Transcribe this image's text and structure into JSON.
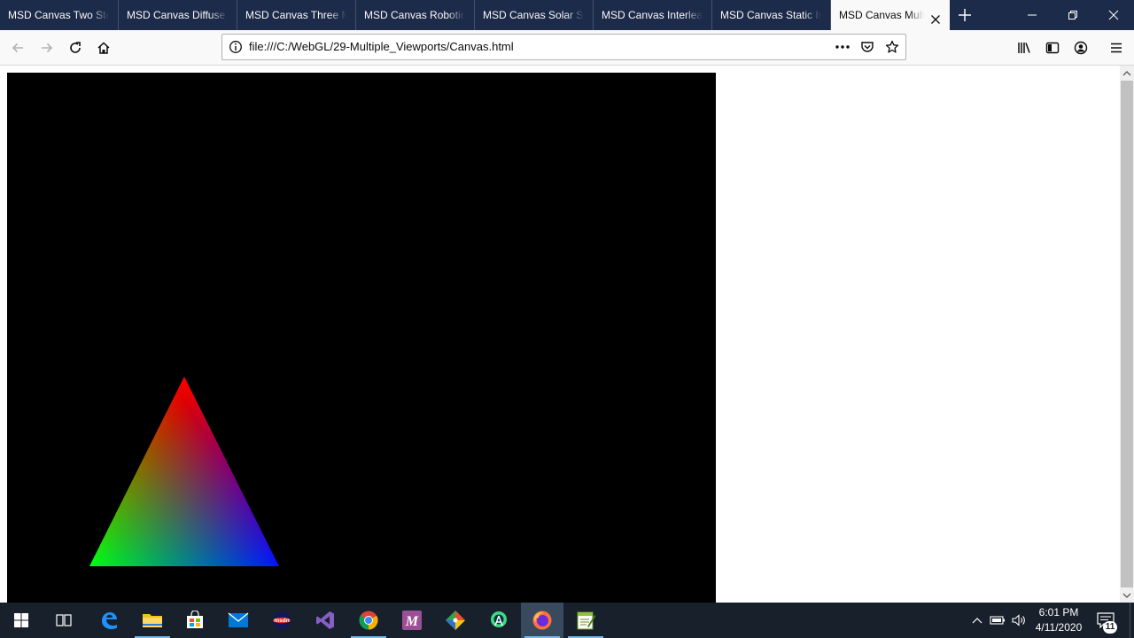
{
  "browser": {
    "tabs": [
      {
        "label": "MSD Canvas Two Steady"
      },
      {
        "label": "MSD Canvas Diffuse Light"
      },
      {
        "label": "MSD Canvas Three Models"
      },
      {
        "label": "MSD Canvas Robotic Arm"
      },
      {
        "label": "MSD Canvas Solar System"
      },
      {
        "label": "MSD Canvas Interleaved"
      },
      {
        "label": "MSD Canvas Static Index"
      },
      {
        "label": "MSD Canvas Multiple Viewports",
        "active": true
      }
    ],
    "address": "file:///C:/WebGL/29-Multiple_Viewports/Canvas.html",
    "icons": {
      "back": "arrow-left-icon",
      "forward": "arrow-right-icon",
      "reload": "reload-icon",
      "home": "home-icon",
      "site_info": "info-icon",
      "page_actions": "ellipsis-icon",
      "pocket": "pocket-icon",
      "bookmark": "star-icon",
      "library": "library-icon",
      "sidebar": "sidebar-icon",
      "account": "account-icon",
      "menu": "hamburger-icon"
    }
  },
  "canvas": {
    "background": "#000000",
    "triangle_colors": {
      "top": "#ff0000",
      "bottom_left": "#00ff00",
      "bottom_right": "#0000ff"
    }
  },
  "taskbar": {
    "apps": [
      {
        "name": "Start",
        "icon": "windows-icon"
      },
      {
        "name": "Task View",
        "icon": "task-view-icon"
      },
      {
        "name": "Microsoft Edge",
        "icon": "edge-icon"
      },
      {
        "name": "File Explorer",
        "icon": "folder-icon",
        "running": true
      },
      {
        "name": "Microsoft Store",
        "icon": "store-icon"
      },
      {
        "name": "Mail",
        "icon": "mail-icon"
      },
      {
        "name": "MSDN",
        "icon": "msdn-icon"
      },
      {
        "name": "Visual Studio",
        "icon": "visual-studio-icon"
      },
      {
        "name": "Google Chrome",
        "icon": "chrome-icon",
        "running": true
      },
      {
        "name": "MATLAB",
        "icon": "m-app-icon"
      },
      {
        "name": "Git",
        "icon": "git-icon"
      },
      {
        "name": "Android Studio",
        "icon": "android-studio-icon"
      },
      {
        "name": "Firefox",
        "icon": "firefox-icon",
        "running": true,
        "active": true
      },
      {
        "name": "Notepad++",
        "icon": "notepad-icon",
        "running": true
      }
    ],
    "clock": {
      "time": "6:01 PM",
      "date": "4/11/2020"
    },
    "notifications_count": "11"
  },
  "colors": {
    "tabstrip_bg": "#1d2b4a",
    "taskbar_bg": "#17202b",
    "toolbar_bg": "#f9f9fa",
    "accent": "#76b9ed"
  }
}
